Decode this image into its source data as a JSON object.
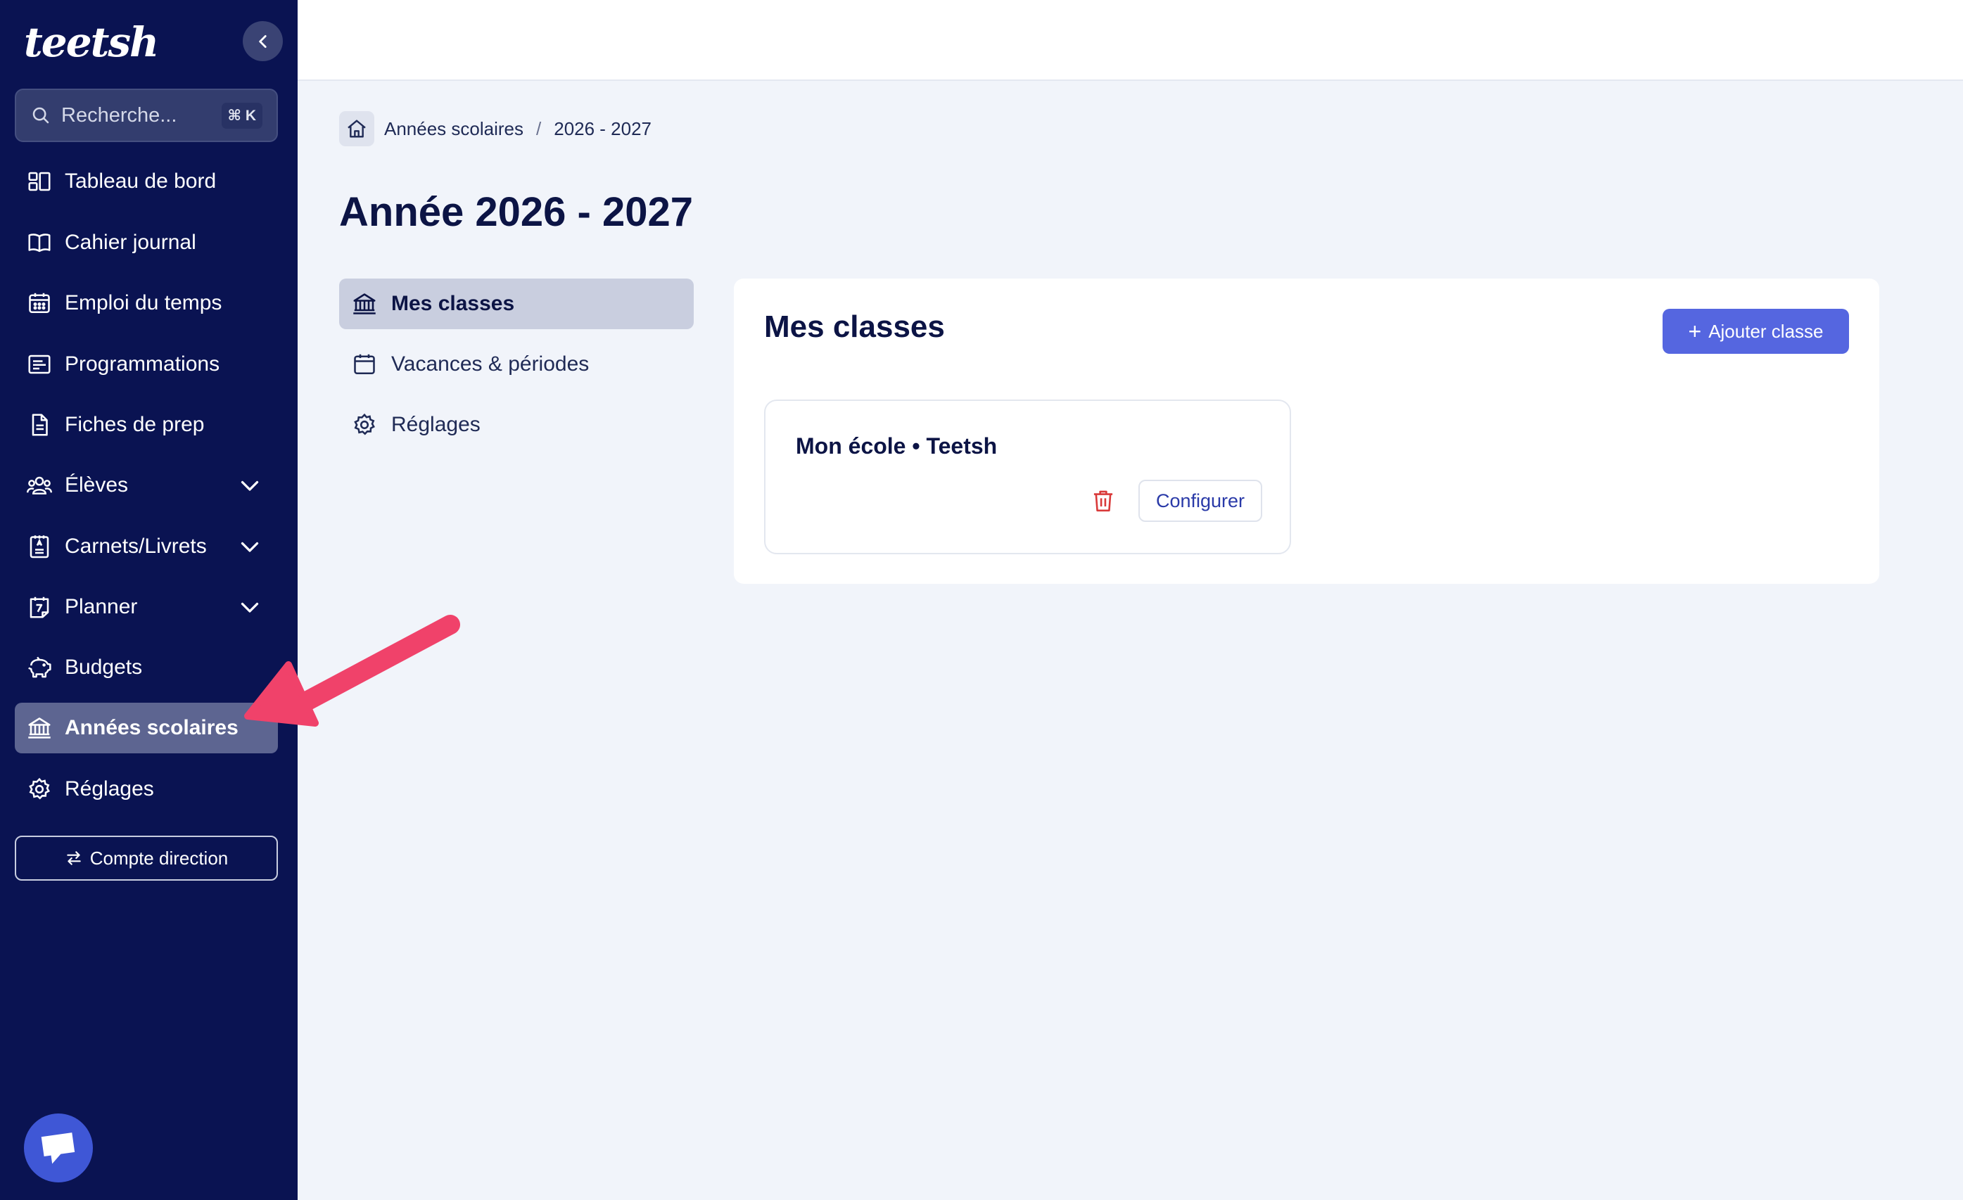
{
  "app": {
    "logo_text": "teetsh"
  },
  "search": {
    "placeholder": "Recherche...",
    "shortcut": "⌘ K"
  },
  "sidebar": {
    "items": [
      {
        "label": "Tableau de bord",
        "icon": "dashboard-icon"
      },
      {
        "label": "Cahier journal",
        "icon": "book-icon"
      },
      {
        "label": "Emploi du temps",
        "icon": "calendar-grid-icon"
      },
      {
        "label": "Programmations",
        "icon": "list-board-icon"
      },
      {
        "label": "Fiches de prep",
        "icon": "document-icon"
      },
      {
        "label": "Élèves",
        "icon": "users-icon",
        "expandable": true
      },
      {
        "label": "Carnets/Livrets",
        "icon": "notebook-icon",
        "expandable": true
      },
      {
        "label": "Planner",
        "icon": "planner-icon",
        "expandable": true
      },
      {
        "label": "Budgets",
        "icon": "piggy-bank-icon"
      },
      {
        "label": "Années scolaires",
        "icon": "institution-icon",
        "active": true
      },
      {
        "label": "Réglages",
        "icon": "gear-icon"
      }
    ],
    "switch_account_label": "Compte direction"
  },
  "breadcrumb": {
    "items": [
      "Années scolaires",
      "2026 - 2027"
    ],
    "separator": "/"
  },
  "page": {
    "title": "Année 2026 - 2027"
  },
  "subnav": {
    "items": [
      {
        "label": "Mes classes",
        "icon": "institution-icon",
        "active": true
      },
      {
        "label": "Vacances & périodes",
        "icon": "calendar-icon"
      },
      {
        "label": "Réglages",
        "icon": "gear-icon"
      }
    ]
  },
  "main": {
    "section_title": "Mes classes",
    "add_button_label": "Ajouter classe",
    "classes": [
      {
        "name": "Mon école • Teetsh",
        "configure_label": "Configurer"
      }
    ]
  },
  "colors": {
    "sidebar_bg": "#0a1352",
    "accent": "#5566e0",
    "annotation_arrow": "#f0426a",
    "delete": "#d93a3a"
  }
}
